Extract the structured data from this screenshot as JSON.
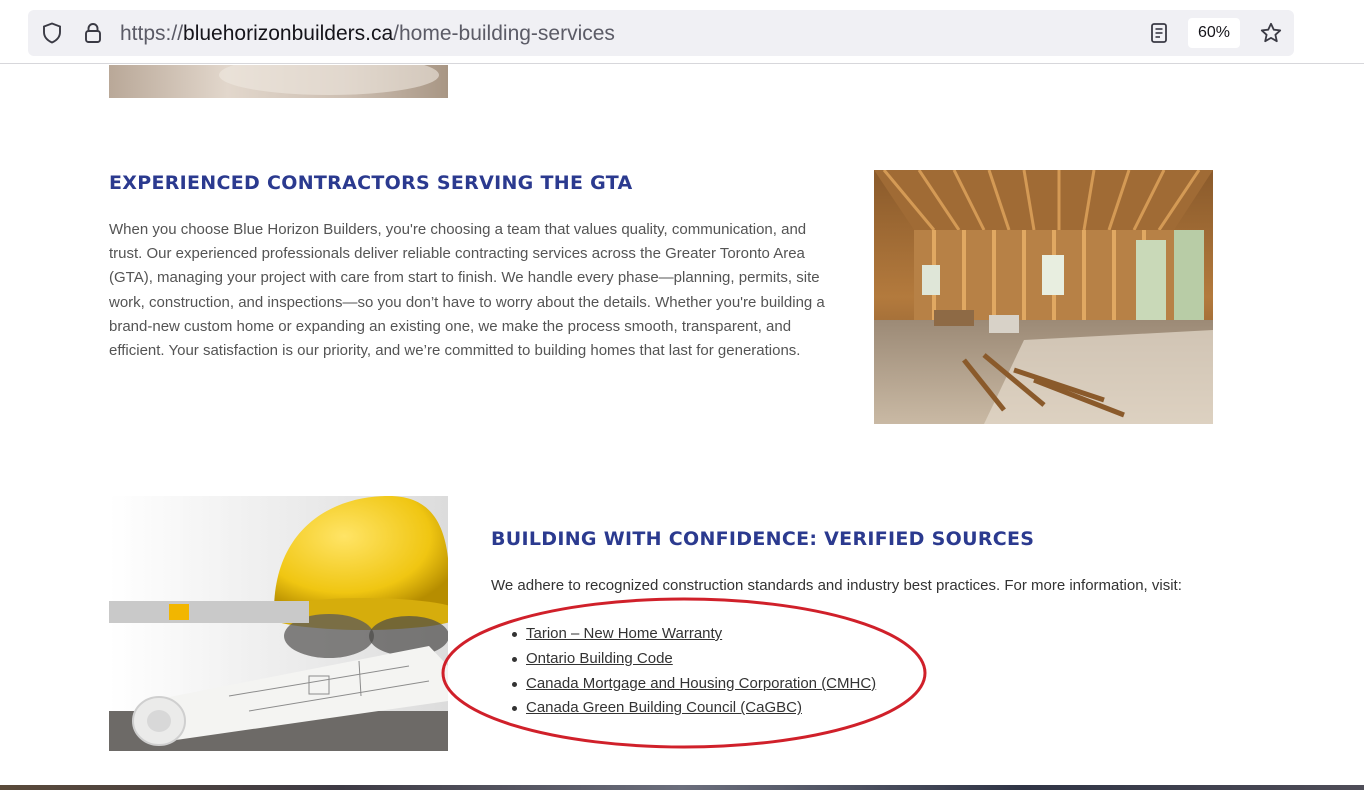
{
  "browser": {
    "url_scheme": "https://",
    "url_domain": "bluehorizonbuilders.ca",
    "url_path": "/home-building-services",
    "zoom": "60%"
  },
  "section_contractors": {
    "heading": "EXPERIENCED CONTRACTORS SERVING THE GTA",
    "body": "When you choose Blue Horizon Builders, you're choosing a team that values quality, communication, and trust. Our experienced professionals deliver reliable contracting services across the Greater Toronto Area (GTA), managing your project with care from start to finish. We handle every phase—planning, permits, site work, construction, and inspections—so you don’t have to worry about the details. Whether you're building a brand-new custom home or expanding an existing one, we make the process smooth, transparent, and efficient. Your satisfaction is our priority, and we’re committed to building homes that last for generations."
  },
  "section_sources": {
    "heading": "BUILDING WITH CONFIDENCE: VERIFIED SOURCES",
    "intro": "We adhere to recognized construction standards and industry best practices. For more information, visit:",
    "links": [
      "Tarion – New Home Warranty",
      "Ontario Building Code",
      "Canada Mortgage and Housing Corporation (CMHC)",
      "Canada Green Building Council (CaGBC)"
    ]
  },
  "colors": {
    "heading": "#2b3a8f",
    "annotation": "#d0202a"
  },
  "icons": [
    "shield-icon",
    "lock-icon",
    "reader-view-icon",
    "bookmark-star-icon"
  ]
}
